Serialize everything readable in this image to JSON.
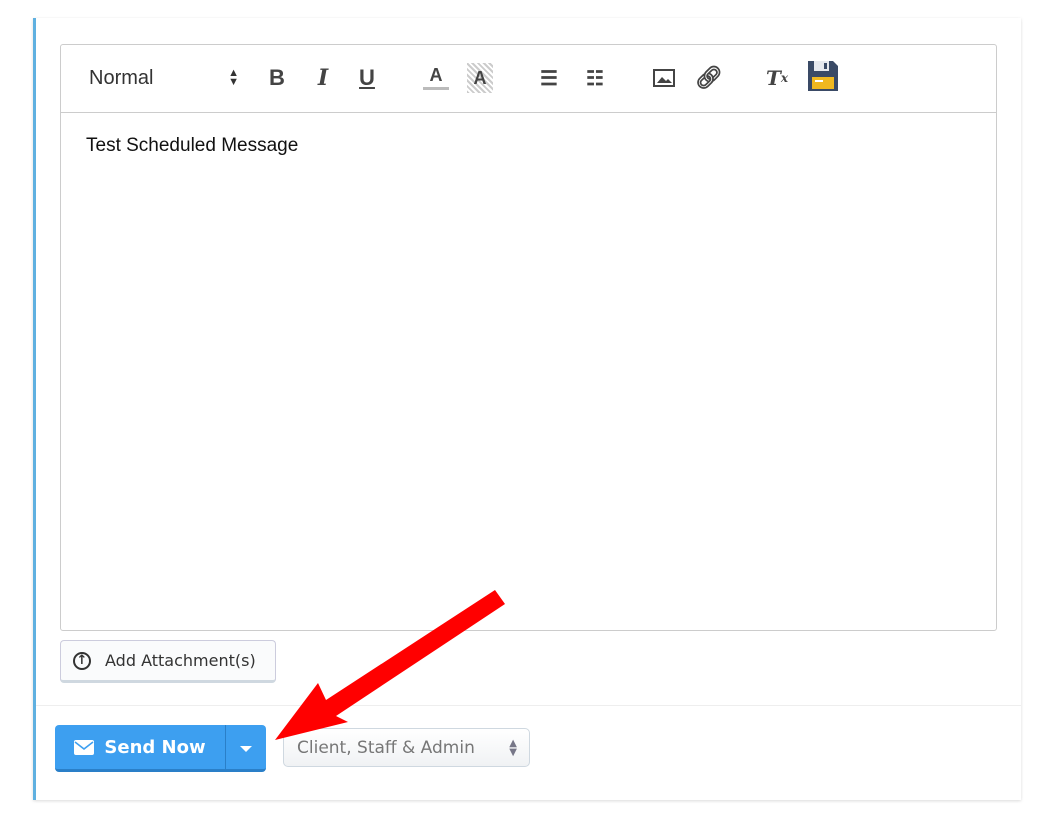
{
  "toolbar": {
    "format_select": "Normal",
    "buttons": [
      "bold",
      "italic",
      "underline",
      "text-color",
      "background-color",
      "ordered-list",
      "bullet-list",
      "image",
      "link",
      "clear-formatting",
      "save"
    ]
  },
  "editor": {
    "content": "Test Scheduled Message"
  },
  "attachment": {
    "label": "Add Attachment(s)"
  },
  "send": {
    "label": "Send Now",
    "color": "#3d9ff0"
  },
  "audience": {
    "selected": "Client, Staff & Admin"
  },
  "annotation": {
    "arrow_color": "#ff0000"
  }
}
